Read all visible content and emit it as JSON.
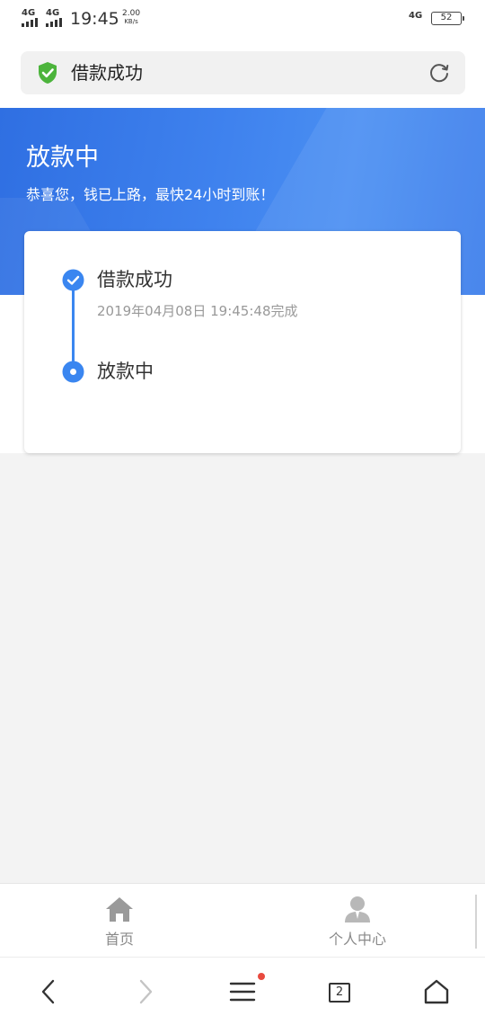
{
  "status_bar": {
    "network1": "4G",
    "network2": "4G",
    "time": "19:45",
    "speed_value": "2.00",
    "speed_unit": "KB/s",
    "network3": "4G",
    "battery": "52"
  },
  "url_bar": {
    "title": "借款成功",
    "shield_icon": "shield-check-icon",
    "refresh_icon": "refresh-icon",
    "shield_color": "#4cb43c"
  },
  "hero": {
    "title": "放款中",
    "subtitle": "恭喜您，钱已上路，最快24小时到账！",
    "color": "#3a7ceb"
  },
  "steps": [
    {
      "title": "借款成功",
      "time": "2019年04月08日 19:45:48完成",
      "state": "done"
    },
    {
      "title": "放款中",
      "state": "current"
    }
  ],
  "tabbar": {
    "items": [
      {
        "label": "首页",
        "icon": "home-icon"
      },
      {
        "label": "个人中心",
        "icon": "user-icon"
      }
    ]
  },
  "browser_nav": {
    "tabs_count": "2",
    "icons": [
      "back-icon",
      "forward-icon",
      "menu-icon",
      "tabs-icon",
      "home-icon"
    ]
  },
  "colors": {
    "accent": "#3a86f0",
    "notification_dot": "#e84a3f"
  }
}
